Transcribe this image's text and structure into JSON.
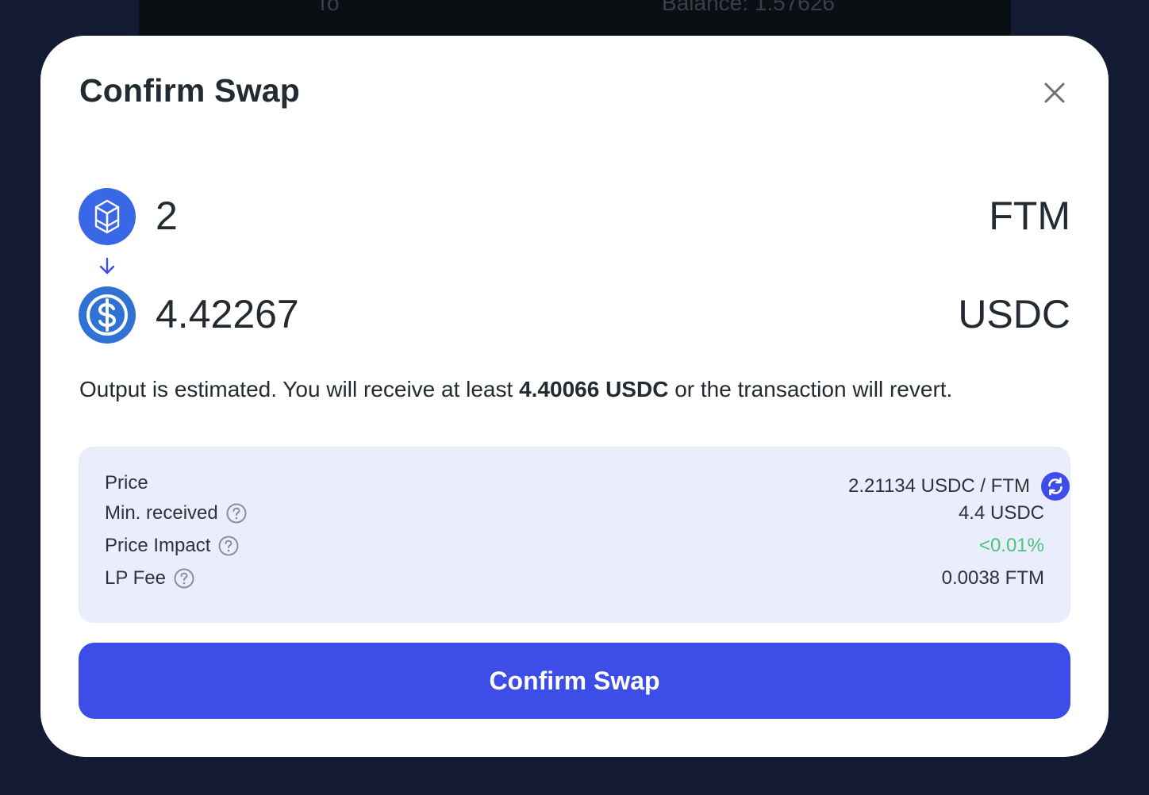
{
  "background": {
    "label": "To",
    "balance": "Balance: 1.57626"
  },
  "modal": {
    "title": "Confirm Swap",
    "close_icon": "close-icon"
  },
  "swap": {
    "from": {
      "amount": "2",
      "symbol": "FTM",
      "icon": "fantom-token-icon",
      "color": "#3a67e6"
    },
    "to": {
      "amount": "4.42267",
      "symbol": "USDC",
      "icon": "usdc-token-icon",
      "color": "#2f72d4"
    },
    "arrow_icon": "arrow-down-icon"
  },
  "note": {
    "prefix": "Output is estimated. You will receive at least ",
    "min_amount": "4.40066 USDC",
    "suffix": " or the transaction will revert."
  },
  "details": {
    "price": {
      "label": "Price",
      "value": "2.21134 USDC / FTM"
    },
    "min_received": {
      "label": "Min. received",
      "value": "4.4 USDC"
    },
    "price_impact": {
      "label": "Price Impact",
      "value": "<0.01%"
    },
    "lp_fee": {
      "label": "LP Fee",
      "value": "0.0038 FTM"
    }
  },
  "button": {
    "label": "Confirm Swap"
  },
  "colors": {
    "accent": "#3d4de8",
    "panel": "#eaedfb",
    "positive": "#4bc27e",
    "overlay": "#121b33"
  }
}
